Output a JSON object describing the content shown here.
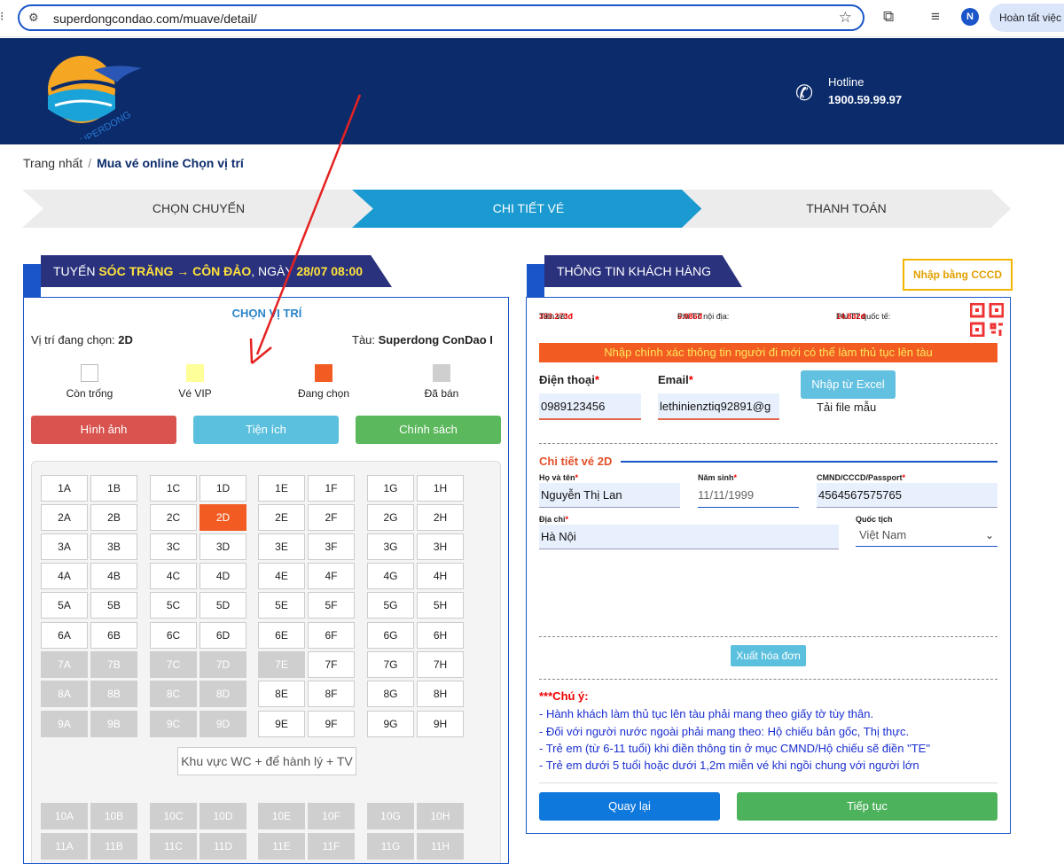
{
  "browser": {
    "url": "superdongcondao.com/muave/detail/",
    "avatar_letter": "N",
    "finish_label": "Hoàn tất việc c"
  },
  "header": {
    "brand": "SUPERDONG",
    "hotline_label": "Hotline",
    "hotline_number": "1900.59.99.97"
  },
  "breadcrumb": {
    "home": "Trang nhất",
    "separator": "/",
    "current": "Mua vé online Chọn vị trí"
  },
  "steps": [
    {
      "label": "CHỌN CHUYẾN"
    },
    {
      "label": "CHI TIẾT VÉ"
    },
    {
      "label": "THANH TOÁN"
    }
  ],
  "route": {
    "prefix": "TUYẾN ",
    "from": "SÓC TRĂNG",
    "arrow": " → ",
    "to": "CÔN ĐẢO",
    "date_prefix": ", NGÀY ",
    "date": "28/07 08:00"
  },
  "seat_section": {
    "title": "CHỌN VỊ TRÍ",
    "position_label": "Vị trí đang chọn: ",
    "position_value": "2D",
    "ship_label": "Tàu: ",
    "ship_value": "Superdong ConDao I",
    "legend": [
      {
        "label": "Còn trống",
        "color": "#ffffff"
      },
      {
        "label": "Vé VIP",
        "color": "#ffff99"
      },
      {
        "label": "Đang chọn",
        "color": "#f25c22"
      },
      {
        "label": "Đã bán",
        "color": "#cfcfcf"
      }
    ],
    "buttons": {
      "images": "Hình ảnh",
      "utilities": "Tiện ích",
      "policy": "Chính sách"
    },
    "wc_zone": "Khu vực WC + để hành lý + TV",
    "columns": [
      "A",
      "B",
      "C",
      "D",
      "E",
      "F",
      "G",
      "H"
    ],
    "rows": [
      {
        "row": "1",
        "status": [
          "free",
          "free",
          "free",
          "free",
          "free",
          "free",
          "free",
          "free"
        ]
      },
      {
        "row": "2",
        "status": [
          "free",
          "free",
          "free",
          "selected",
          "free",
          "free",
          "free",
          "free"
        ]
      },
      {
        "row": "3",
        "status": [
          "free",
          "free",
          "free",
          "free",
          "free",
          "free",
          "free",
          "free"
        ]
      },
      {
        "row": "4",
        "status": [
          "free",
          "free",
          "free",
          "free",
          "free",
          "free",
          "free",
          "free"
        ]
      },
      {
        "row": "5",
        "status": [
          "free",
          "free",
          "free",
          "free",
          "free",
          "free",
          "free",
          "free"
        ]
      },
      {
        "row": "6",
        "status": [
          "free",
          "free",
          "free",
          "free",
          "free",
          "free",
          "free",
          "free"
        ]
      },
      {
        "row": "7",
        "status": [
          "sold",
          "sold",
          "sold",
          "sold",
          "sold",
          "free",
          "free",
          "free"
        ]
      },
      {
        "row": "8",
        "status": [
          "sold",
          "sold",
          "sold",
          "sold",
          "free",
          "free",
          "free",
          "free"
        ]
      },
      {
        "row": "9",
        "status": [
          "sold",
          "sold",
          "sold",
          "sold",
          "free",
          "free",
          "free",
          "free"
        ]
      },
      {
        "row": "10",
        "status": [
          "sold",
          "sold",
          "sold",
          "sold",
          "sold",
          "sold",
          "sold",
          "sold"
        ]
      },
      {
        "row": "11",
        "status": [
          "sold",
          "sold",
          "sold",
          "sold",
          "sold",
          "sold",
          "sold",
          "sold"
        ]
      }
    ]
  },
  "customer": {
    "title": "THÔNG TIN KHÁCH HÀNG",
    "cccd_button": "Nhập bằng CCCD",
    "fees": {
      "ticket_label": "Tiền vé: ",
      "ticket_value": "393.273đ",
      "domestic_label": "Phí TT nội địa: ",
      "domestic_value": "6.086đ",
      "intl_label": "Phí TT quốc tế: ",
      "intl_value": "14.832đ"
    },
    "warning": "Nhập chính xác thông tin người đi mới có thể làm thủ tục lên tàu",
    "phone_label": "Điện thoại",
    "phone_value": "0989123456",
    "email_label": "Email",
    "email_value": "lethinienztiq92891@g",
    "excel_button": "Nhập từ Excel",
    "template_link": "Tải file mẫu",
    "ticket_title": "Chi tiết vé 2D",
    "fullname_label": "Họ và tên",
    "fullname_value": "Nguyễn Thị Lan",
    "birth_label": "Năm sinh",
    "birth_value": "11/11/1999",
    "id_label": "CMND/CCCD/Passport",
    "id_value": "4564567575765",
    "address_label": "Địa chỉ",
    "address_value": "Hà Nội",
    "nationality_label": "Quốc tịch",
    "nationality_value": "Việt Nam",
    "asterisk": "*",
    "invoice_button": "Xuất hóa đơn",
    "note_title": "***Chú ý:",
    "notes": [
      "- Hành khách làm thủ tục lên tàu phải mang theo giấy tờ tùy thân.",
      "- Đối với người nước ngoài phải mang theo: Hộ chiếu bản gốc, Thị thực.",
      "- Trẻ em (từ 6-11 tuổi) khi điền thông tin ở mục CMND/Hộ chiếu sẽ điền \"TE\"",
      "- Trẻ em dưới 5 tuổi hoặc dưới 1,2m miễn vé khi ngồi chung với người lớn"
    ],
    "back_button": "Quay lại",
    "next_button": "Tiếp tục"
  }
}
